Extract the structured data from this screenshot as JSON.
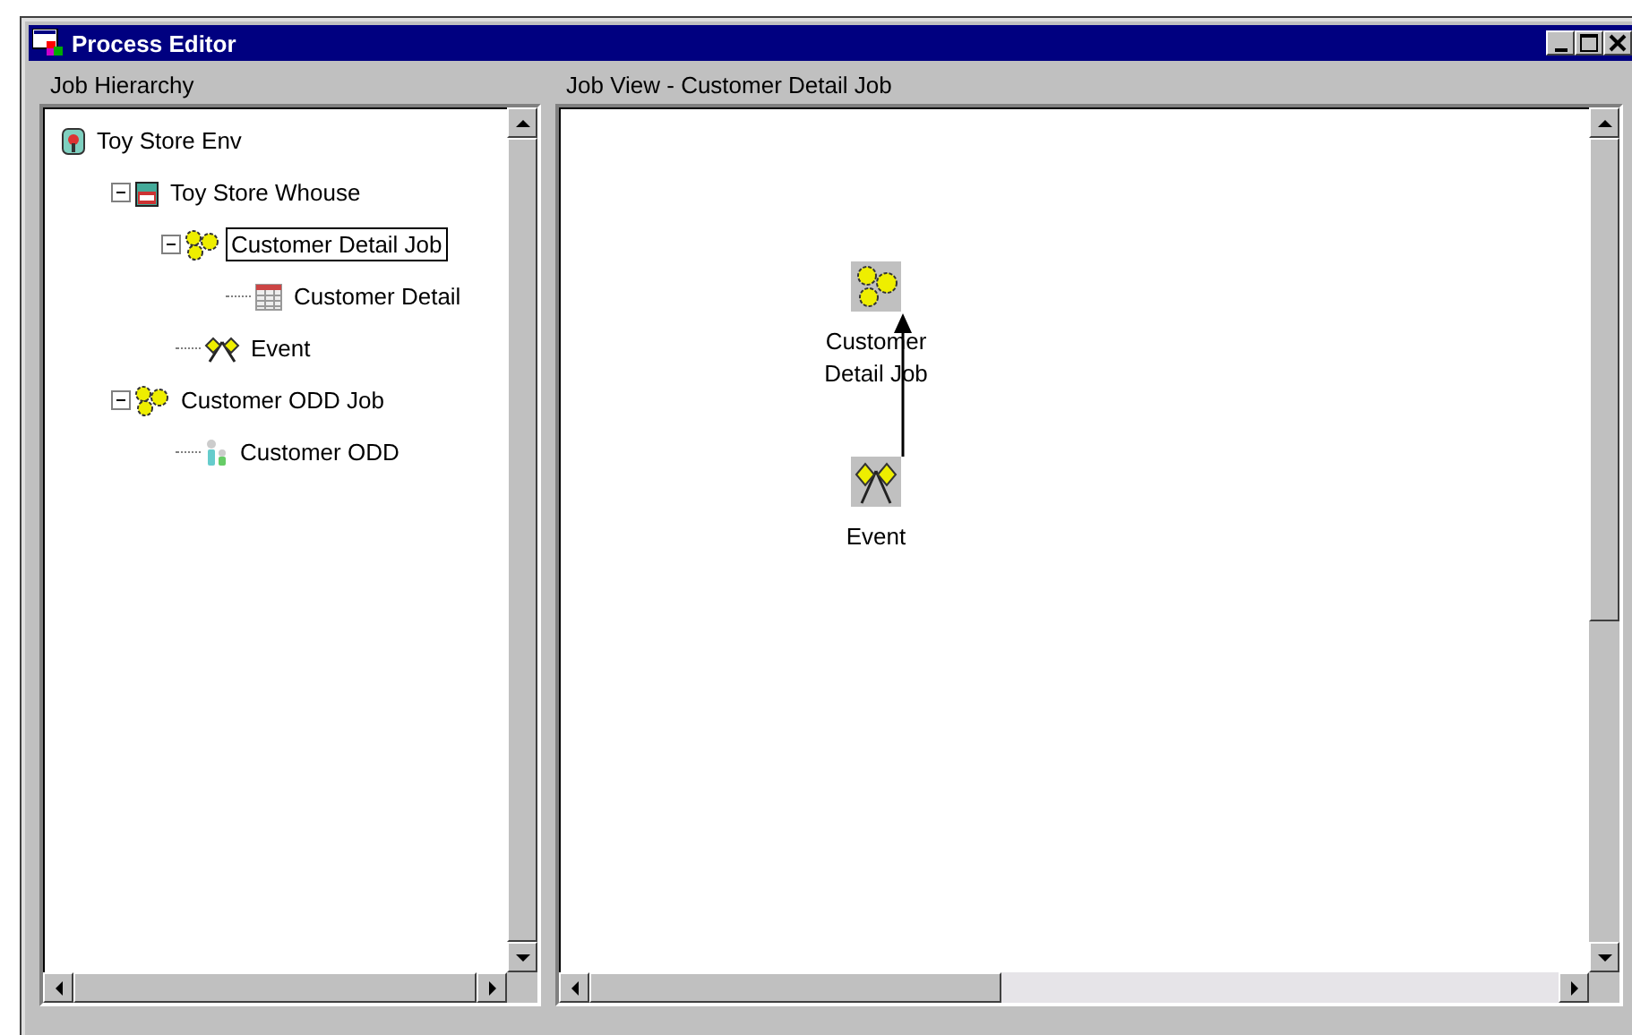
{
  "window": {
    "title": "Process Editor"
  },
  "hierarchy": {
    "label": "Job Hierarchy",
    "items": [
      {
        "label": "Toy Store Env",
        "kind": "env",
        "selected": false,
        "children": [
          {
            "label": "Toy Store Whouse",
            "kind": "warehouse",
            "selected": false,
            "expanded": true,
            "children": [
              {
                "label": "Customer Detail Job",
                "kind": "job",
                "selected": true,
                "expanded": true,
                "children": [
                  {
                    "label": "Customer Detail",
                    "kind": "table",
                    "selected": false
                  }
                ]
              },
              {
                "label": "Event",
                "kind": "event",
                "selected": false
              }
            ]
          },
          {
            "label": "Customer ODD Job",
            "kind": "job",
            "selected": false,
            "expanded": true,
            "children": [
              {
                "label": "Customer ODD",
                "kind": "odd",
                "selected": false
              }
            ]
          }
        ]
      }
    ]
  },
  "job_view": {
    "label": "Job View - Customer Detail Job",
    "nodes": [
      {
        "label": "Customer Detail Job",
        "kind": "job"
      },
      {
        "label": "Event",
        "kind": "event"
      }
    ]
  }
}
